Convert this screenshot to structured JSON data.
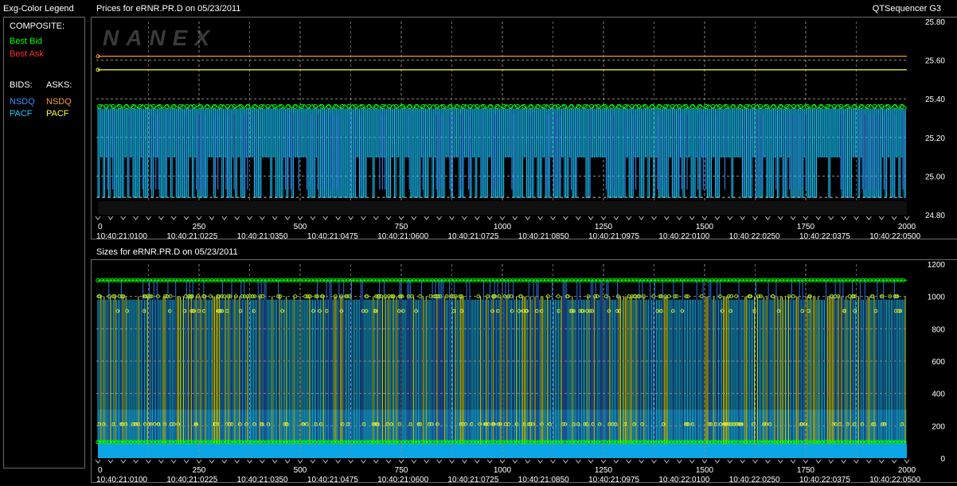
{
  "window": {
    "legend_title": "Exg-Color Legend",
    "app_title": "QTSequencer G3",
    "watermark": "NANEX"
  },
  "legend": {
    "composite_label": "COMPOSITE:",
    "best_bid": "Best Bid",
    "best_ask": "Best Ask",
    "bids_label": "BIDS:",
    "asks_label": "ASKS:",
    "bids": [
      "NSDQ",
      "PACF"
    ],
    "asks": [
      "NSDQ",
      "PACF"
    ]
  },
  "colors": {
    "best_bid": "#00ff00",
    "best_ask": "#ff3030",
    "nsdq_bid": "#3a8cff",
    "pacf_bid": "#18c8ff",
    "nsdq_ask": "#ff9a30",
    "pacf_ask": "#ffff40",
    "grid": "#8a8a8a",
    "panel_border": "#6a6a6a"
  },
  "chart_data": [
    {
      "type": "line",
      "title": "Prices for  eRNR.PR.D  on  05/23/2011",
      "x_ticks": [
        "0",
        "250",
        "500",
        "750",
        "1000",
        "1250",
        "1500",
        "1750",
        "2000"
      ],
      "time_labels": [
        "10:40:21:0100",
        "10:40:21:0225",
        "10:40:21:0350",
        "10:40:21:0475",
        "10:40:21:0600",
        "10:40:21:0725",
        "10:40:21:0850",
        "10:40:21:0975",
        "10:40:22:0100",
        "10:40:22:0250",
        "10:40:22:0375",
        "10:40:22:0500"
      ],
      "y_ticks": [
        "25.80",
        "25.60",
        "25.40",
        "25.20",
        "25.00",
        "24.80"
      ],
      "xlim": [
        0,
        2000
      ],
      "ylim": [
        24.8,
        25.8
      ],
      "grid": true,
      "series_levels": {
        "nsdq_ask": 25.62,
        "pacf_ask": 25.55,
        "best_bid_high": 25.35,
        "best_bid_low": 24.89,
        "bid_mid": 25.1
      }
    },
    {
      "type": "bar",
      "title": "Sizes for  eRNR.PR.D  on  05/23/2011",
      "x_ticks": [
        "0",
        "250",
        "500",
        "750",
        "1000",
        "1250",
        "1500",
        "1750",
        "2000"
      ],
      "time_labels": [
        "10:40:21:0100",
        "10:40:21:0225",
        "10:40:21:0350",
        "10:40:21:0475",
        "10:40:21:0600",
        "10:40:21:0725",
        "10:40:21:0850",
        "10:40:21:0975",
        "10:40:22:0100",
        "10:40:22:0250",
        "10:40:22:0375",
        "10:40:22:0500"
      ],
      "y_ticks": [
        "1200",
        "1000",
        "800",
        "600",
        "400",
        "200",
        "0"
      ],
      "xlim": [
        0,
        2000
      ],
      "ylim": [
        0,
        1200
      ],
      "grid": true,
      "series_levels": {
        "best_bid_high": 1100,
        "best_bid_mid": 1000,
        "best_bid_low": 100,
        "pacf_level": 300,
        "base_level": 90
      }
    }
  ]
}
